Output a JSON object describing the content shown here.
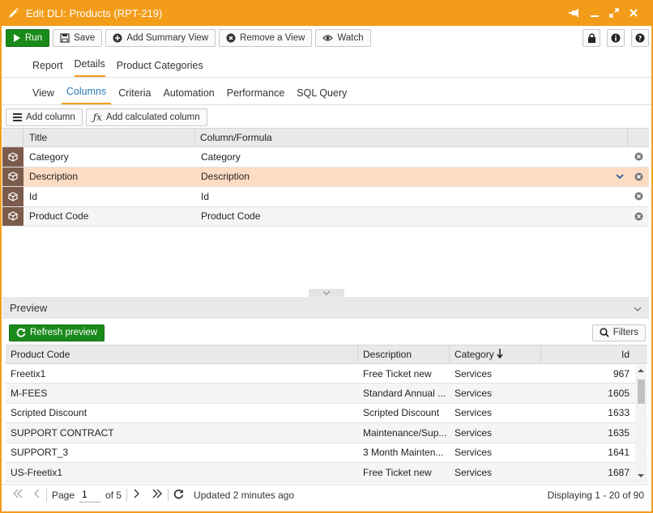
{
  "window": {
    "title": "Edit DLI: Products (RPT-219)"
  },
  "toolbar": {
    "run": "Run",
    "save": "Save",
    "add_summary_view": "Add Summary View",
    "remove_view": "Remove a View",
    "watch": "Watch"
  },
  "main_tabs": [
    "Report",
    "Details",
    "Product Categories"
  ],
  "sub_tabs": [
    "View",
    "Columns",
    "Criteria",
    "Automation",
    "Performance",
    "SQL Query"
  ],
  "columns_toolbar": {
    "add_column": "Add column",
    "add_calculated": "Add calculated column"
  },
  "columns_grid": {
    "headers": [
      "Title",
      "Column/Formula"
    ],
    "rows": [
      {
        "title": "Category",
        "formula": "Category"
      },
      {
        "title": "Description",
        "formula": "Description"
      },
      {
        "title": "Id",
        "formula": "Id"
      },
      {
        "title": "Product Code",
        "formula": "Product Code"
      }
    ]
  },
  "preview": {
    "title": "Preview",
    "refresh": "Refresh preview",
    "filters": "Filters",
    "headers": [
      "Product Code",
      "Description",
      "Category",
      "Id"
    ],
    "rows": [
      [
        "Freetix1",
        "Free Ticket new",
        "Services",
        "967"
      ],
      [
        "M-FEES",
        "Standard Annual ...",
        "Services",
        "1605"
      ],
      [
        "Scripted Discount",
        "Scripted Discount",
        "Services",
        "1633"
      ],
      [
        "SUPPORT CONTRACT",
        "Maintenance/Sup...",
        "Services",
        "1635"
      ],
      [
        "SUPPORT_3",
        "3 Month Mainten...",
        "Services",
        "1641"
      ],
      [
        "US-Freetix1",
        "Free Ticket new",
        "Services",
        "1687"
      ]
    ]
  },
  "pager": {
    "page_label": "Page",
    "page_value": "1",
    "of_label": "of 5",
    "updated": "Updated 2 minutes ago",
    "displaying": "Displaying 1 - 20 of 90"
  },
  "colors": {
    "accent": "#f39c1a",
    "run_green": "#1a8a1a",
    "selected_row": "#fddcc4",
    "row_icon_bg": "#7b5b4b"
  }
}
